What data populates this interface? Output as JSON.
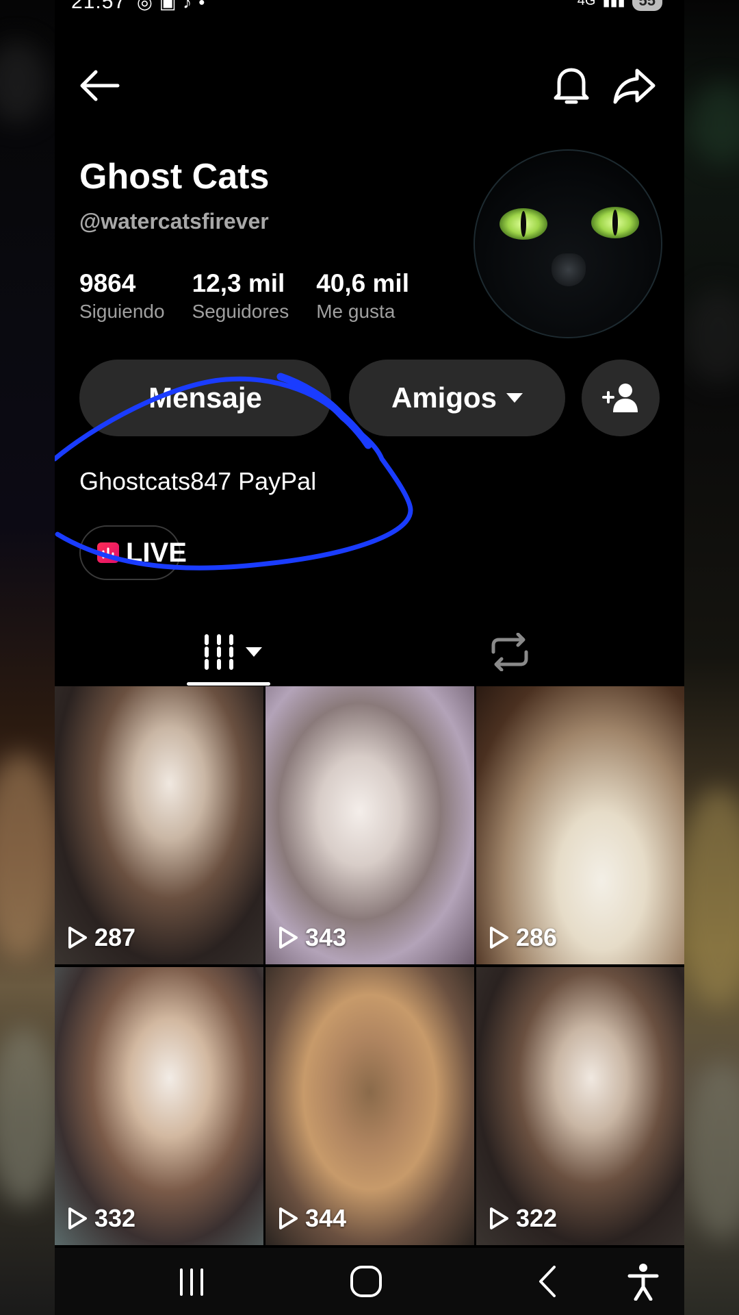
{
  "status_bar": {
    "time": "21:57",
    "network": "4G",
    "battery": "55"
  },
  "profile": {
    "name": "Ghost Cats",
    "handle": "@watercatsfirever",
    "stats": [
      {
        "value": "9864",
        "label": "Siguiendo"
      },
      {
        "value": "12,3 mil",
        "label": "Seguidores"
      },
      {
        "value": "40,6 mil",
        "label": "Me gusta"
      }
    ],
    "bio": "Ghostcats847 PayPal",
    "live_label": "LIVE"
  },
  "actions": {
    "message": "Mensaje",
    "friends": "Amigos"
  },
  "videos": [
    {
      "views": "287"
    },
    {
      "views": "343"
    },
    {
      "views": "286"
    },
    {
      "views": "332"
    },
    {
      "views": "344"
    },
    {
      "views": "322"
    }
  ],
  "colors": {
    "background": "#000000",
    "button_bg": "#2a2a2a",
    "annotation": "#1a3cff",
    "secondary_text": "#a0a0a0"
  },
  "icons": [
    "back-arrow-icon",
    "bell-icon",
    "share-icon",
    "add-friend-icon",
    "grid-icon",
    "repost-icon",
    "play-icon",
    "recent-apps-icon",
    "home-icon",
    "nav-back-icon",
    "accessibility-icon"
  ]
}
